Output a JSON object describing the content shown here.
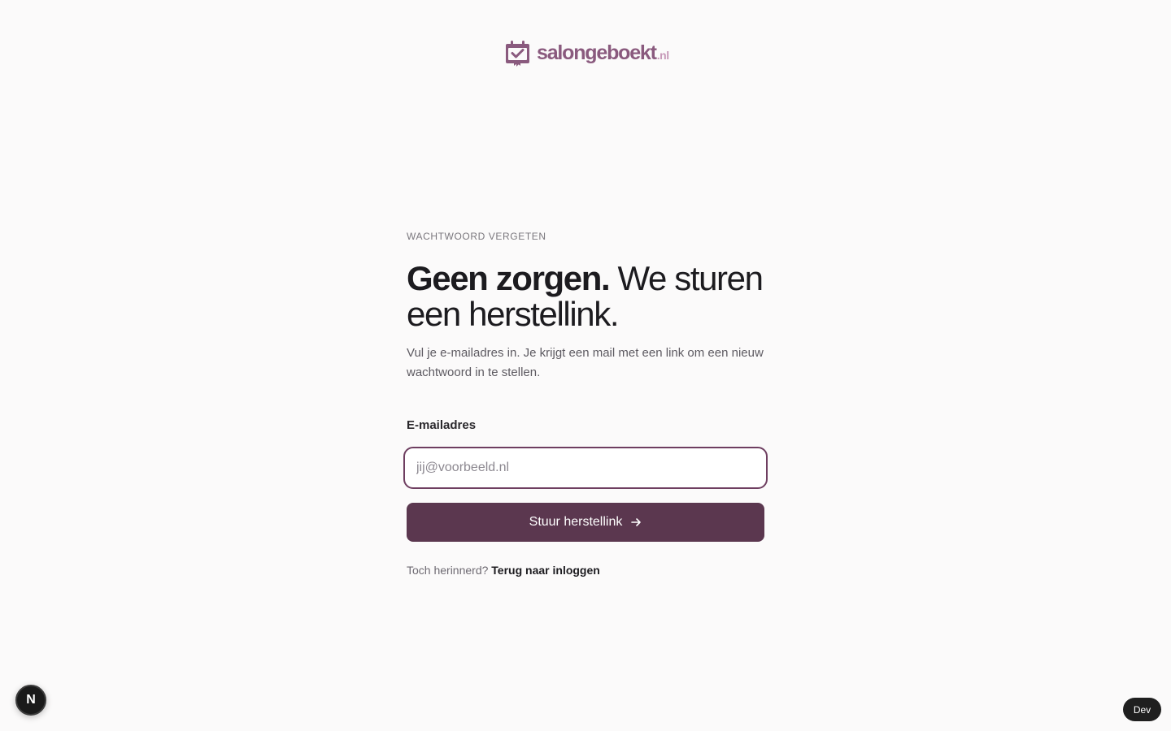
{
  "brand": {
    "name": "salongeboekt",
    "tld": ".nl",
    "icon": "calendar-check-icon",
    "colors": {
      "primary": "#5b374f",
      "logo": "#8a5a7e",
      "logo_tld": "#c79ab9",
      "focus_border": "#6e3e60"
    }
  },
  "form": {
    "eyebrow": "WACHTWOORD VERGETEN",
    "headline_strong": "Geen zorgen.",
    "headline_rest": " We sturen een herstellink.",
    "intro": "Vul je e-mailadres in. Je krijgt een mail met een link om een nieuw wachtwoord in te stellen.",
    "email_label": "E-mailadres",
    "email_placeholder": "jij@voorbeeld.nl",
    "email_value": "",
    "submit_label": "Stuur herstellink",
    "submit_icon": "arrow-right-icon",
    "back_prompt": "Toch herinnerd?",
    "back_link": "Terug naar inloggen"
  },
  "dev": {
    "next_badge": "N",
    "dev_pill": "Dev"
  }
}
